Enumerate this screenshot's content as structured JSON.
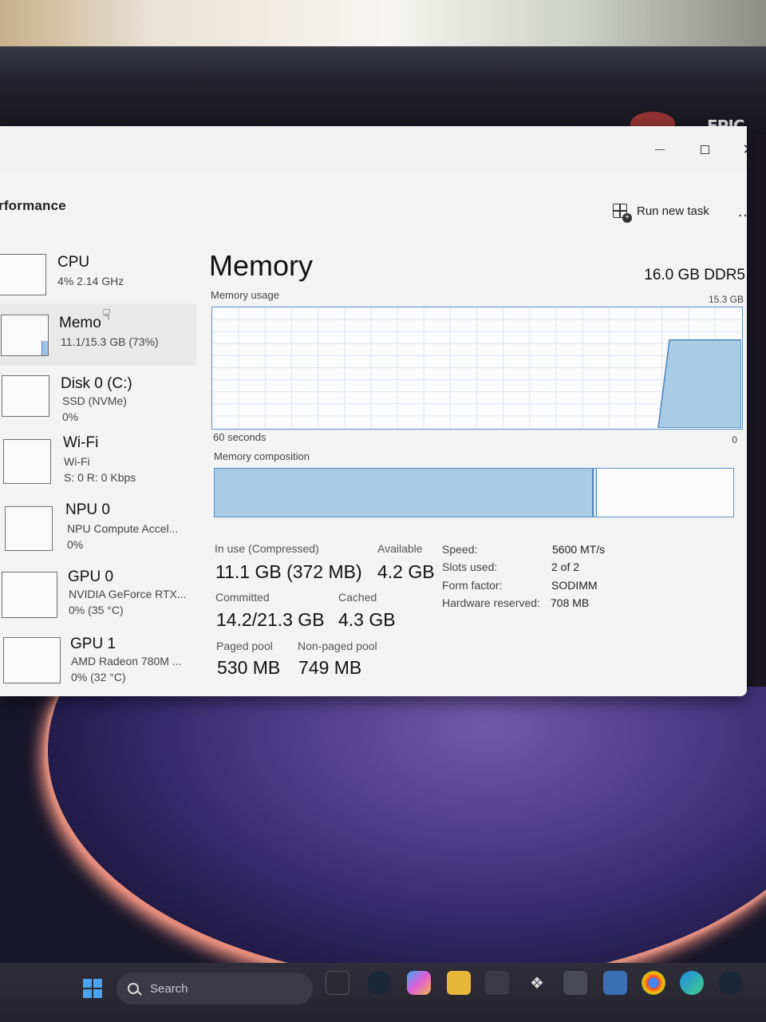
{
  "header": {
    "title": "rformance",
    "run_new_task": "Run new task",
    "more": "…"
  },
  "window_controls": {
    "close": "✕"
  },
  "sidebar": {
    "items": [
      {
        "name": "CPU",
        "sub": "4% 2.14 GHz",
        "sub2": ""
      },
      {
        "name": "Memo",
        "sub": "11.1/15.3 GB (73%)",
        "sub2": ""
      },
      {
        "name": "Disk 0 (C:)",
        "sub": "SSD (NVMe)",
        "sub2": "0%"
      },
      {
        "name": "Wi-Fi",
        "sub": "Wi-Fi",
        "sub2": "S: 0 R: 0 Kbps"
      },
      {
        "name": "NPU 0",
        "sub": "NPU Compute Accel...",
        "sub2": "0%"
      },
      {
        "name": "GPU 0",
        "sub": "NVIDIA GeForce RTX...",
        "sub2": "0% (35 °C)"
      },
      {
        "name": "GPU 1",
        "sub": "AMD Radeon 780M ...",
        "sub2": "0% (32 °C)"
      }
    ],
    "memory_level": 0.73
  },
  "main": {
    "title": "Memory",
    "total": "16.0 GB DDR5",
    "usage_label": "Memory usage",
    "usage_max": "15.3 GB",
    "usage_x_left": "60 seconds",
    "usage_x_right": "0",
    "composition_label": "Memory composition",
    "composition_in_use_fraction": 0.73,
    "stats": {
      "in_use_label": "In use (Compressed)",
      "in_use_value": "11.1 GB (372 MB)",
      "available_label": "Available",
      "available_value": "4.2 GB",
      "committed_label": "Committed",
      "committed_value": "14.2/21.3 GB",
      "cached_label": "Cached",
      "cached_value": "4.3 GB",
      "paged_label": "Paged pool",
      "paged_value": "530 MB",
      "nonpaged_label": "Non-paged pool",
      "nonpaged_value": "749 MB"
    },
    "specs": {
      "speed_label": "Speed:",
      "speed_value": "5600 MT/s",
      "slots_label": "Slots used:",
      "slots_value": "2 of 2",
      "form_label": "Form factor:",
      "form_value": "SODIMM",
      "reserved_label": "Hardware reserved:",
      "reserved_value": "708 MB"
    }
  },
  "taskbar": {
    "search_text": "Search"
  },
  "desktop": {
    "epic_logo": "EPIC"
  },
  "colors": {
    "accent_fill": "#a9cbe6",
    "accent_border": "#4a85c0"
  }
}
